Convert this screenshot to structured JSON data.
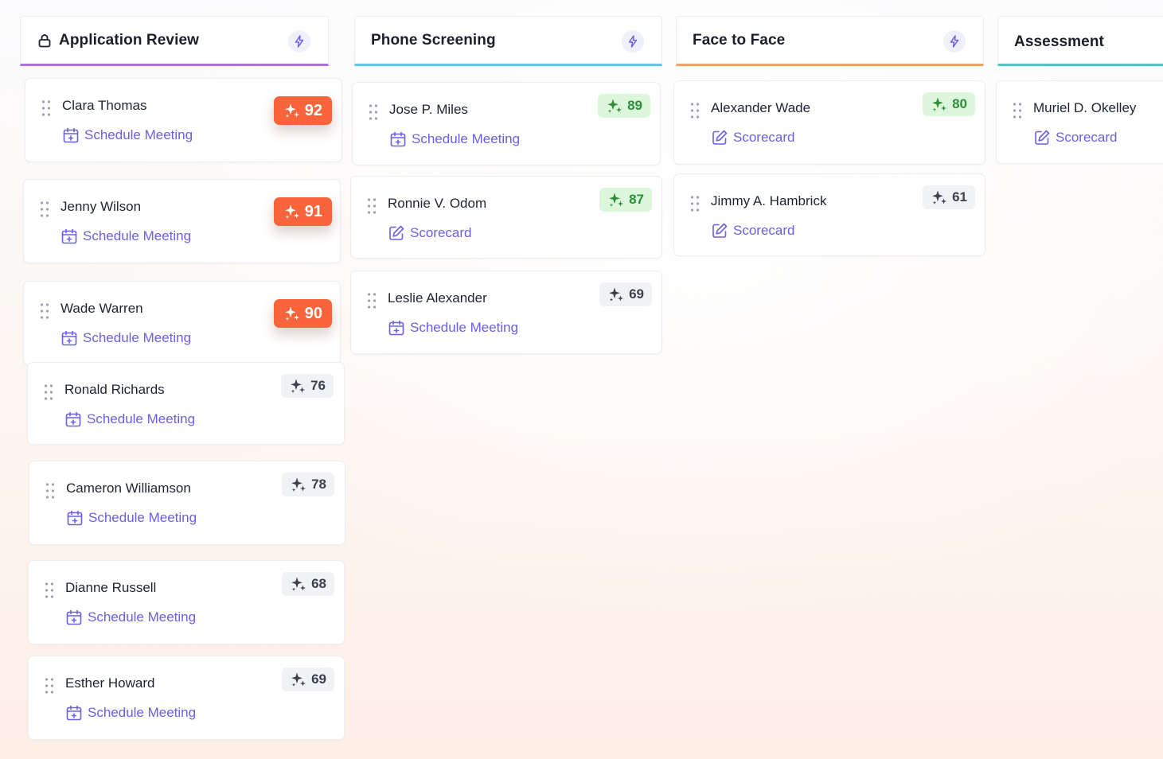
{
  "columns": [
    {
      "title": "Application Review",
      "accent": "#b06de0",
      "cards": [
        {
          "name": "Clara Thomas",
          "action": "Schedule Meeting",
          "action_icon": "calendar-plus-icon",
          "score": "92",
          "tier": "hot"
        },
        {
          "name": "Jenny Wilson",
          "action": "Schedule Meeting",
          "action_icon": "calendar-plus-icon",
          "score": "91",
          "tier": "hot"
        },
        {
          "name": "Wade Warren",
          "action": "Schedule Meeting",
          "action_icon": "calendar-plus-icon",
          "score": "90",
          "tier": "hot"
        },
        {
          "name": "Ronald Richards",
          "action": "Schedule Meeting",
          "action_icon": "calendar-plus-icon",
          "score": "76",
          "tier": "neutral"
        },
        {
          "name": "Cameron Williamson",
          "action": "Schedule Meeting",
          "action_icon": "calendar-plus-icon",
          "score": "78",
          "tier": "neutral"
        },
        {
          "name": "Dianne Russell",
          "action": "Schedule Meeting",
          "action_icon": "calendar-plus-icon",
          "score": "68",
          "tier": "neutral"
        },
        {
          "name": "Esther Howard",
          "action": "Schedule Meeting",
          "action_icon": "calendar-plus-icon",
          "score": "69",
          "tier": "neutral"
        }
      ]
    },
    {
      "title": "Phone Screening",
      "accent": "#5ec8e6",
      "cards": [
        {
          "name": "Jose P. Miles",
          "action": "Schedule Meeting",
          "action_icon": "calendar-plus-icon",
          "score": "89",
          "tier": "good"
        },
        {
          "name": "Ronnie V. Odom",
          "action": "Scorecard",
          "action_icon": "edit-icon",
          "score": "87",
          "tier": "good"
        },
        {
          "name": "Leslie Alexander",
          "action": "Schedule Meeting",
          "action_icon": "calendar-plus-icon",
          "score": "69",
          "tier": "neutral"
        }
      ]
    },
    {
      "title": "Face to Face",
      "accent": "#f3a062",
      "cards": [
        {
          "name": "Alexander Wade",
          "action": "Scorecard",
          "action_icon": "edit-icon",
          "score": "80",
          "tier": "good"
        },
        {
          "name": "Jimmy A. Hambrick",
          "action": "Scorecard",
          "action_icon": "edit-icon",
          "score": "61",
          "tier": "neutral"
        }
      ]
    },
    {
      "title": "Assessment",
      "accent": "#4fc7c2",
      "cards": [
        {
          "name": "Muriel D. Okelley",
          "action": "Scorecard",
          "action_icon": "edit-icon"
        }
      ]
    }
  ],
  "colors": {
    "link": "#6b5fe3",
    "score_hot": "#f9643a",
    "score_good_bg": "#dcf7dc",
    "score_good_text": "#2f8f37",
    "score_neutral_bg": "#f1f2f5"
  },
  "icons": {
    "header_lock": "lock-icon",
    "header_action": "lightning-icon",
    "card_handle": "drag-handle-icon",
    "score": "sparkle-icon"
  }
}
